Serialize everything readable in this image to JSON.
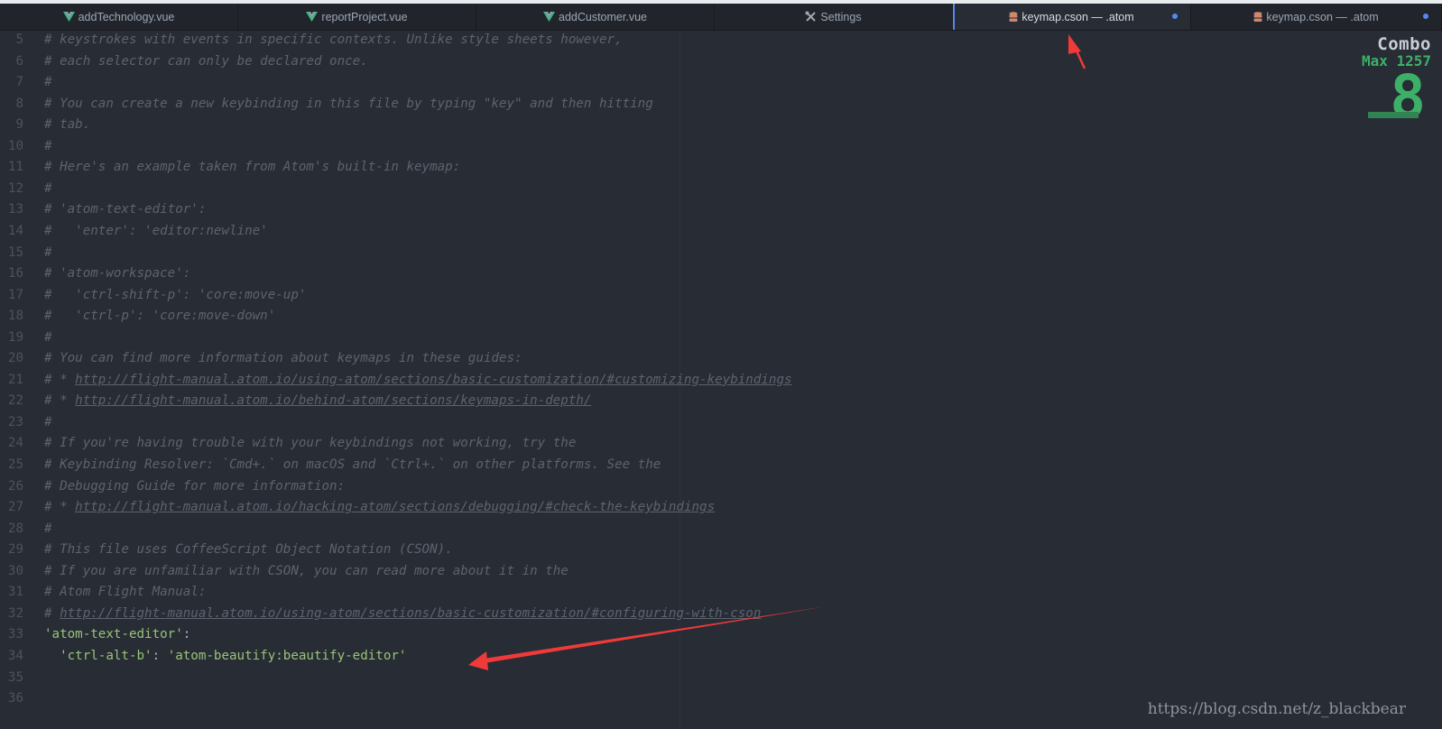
{
  "tabs": [
    {
      "label": "addTechnology.vue",
      "icon": "vue-icon",
      "active": false,
      "modified": false
    },
    {
      "label": "reportProject.vue",
      "icon": "vue-icon",
      "active": false,
      "modified": false
    },
    {
      "label": "addCustomer.vue",
      "icon": "vue-icon",
      "active": false,
      "modified": false
    },
    {
      "label": "Settings",
      "icon": "tools-icon",
      "active": false,
      "modified": false
    },
    {
      "label": "keymap.cson — .atom",
      "icon": "database-icon",
      "active": true,
      "modified": true
    },
    {
      "label": "keymap.cson — .atom",
      "icon": "database-icon",
      "active": false,
      "modified": true
    }
  ],
  "lines": [
    {
      "n": "5",
      "text": "# keystrokes with events in specific contexts. Unlike style sheets however,"
    },
    {
      "n": "6",
      "text": "# each selector can only be declared once."
    },
    {
      "n": "7",
      "text": "#"
    },
    {
      "n": "8",
      "text": "# You can create a new keybinding in this file by typing \"key\" and then hitting"
    },
    {
      "n": "9",
      "text": "# tab."
    },
    {
      "n": "10",
      "text": "#"
    },
    {
      "n": "11",
      "text": "# Here's an example taken from Atom's built-in keymap:"
    },
    {
      "n": "12",
      "text": "#"
    },
    {
      "n": "13",
      "text": "# 'atom-text-editor':"
    },
    {
      "n": "14",
      "text": "#   'enter': 'editor:newline'"
    },
    {
      "n": "15",
      "text": "#"
    },
    {
      "n": "16",
      "text": "# 'atom-workspace':"
    },
    {
      "n": "17",
      "text": "#   'ctrl-shift-p': 'core:move-up'"
    },
    {
      "n": "18",
      "text": "#   'ctrl-p': 'core:move-down'"
    },
    {
      "n": "19",
      "text": "#"
    },
    {
      "n": "20",
      "text": "# You can find more information about keymaps in these guides:"
    },
    {
      "n": "21",
      "text": "# * ",
      "link": "http://flight-manual.atom.io/using-atom/sections/basic-customization/#customizing-keybindings"
    },
    {
      "n": "22",
      "text": "# * ",
      "link": "http://flight-manual.atom.io/behind-atom/sections/keymaps-in-depth/"
    },
    {
      "n": "23",
      "text": "#"
    },
    {
      "n": "24",
      "text": "# If you're having trouble with your keybindings not working, try the"
    },
    {
      "n": "25",
      "text": "# Keybinding Resolver: `Cmd+.` on macOS and `Ctrl+.` on other platforms. See the"
    },
    {
      "n": "26",
      "text": "# Debugging Guide for more information:"
    },
    {
      "n": "27",
      "text": "# * ",
      "link": "http://flight-manual.atom.io/hacking-atom/sections/debugging/#check-the-keybindings"
    },
    {
      "n": "28",
      "text": "#"
    },
    {
      "n": "29",
      "text": "# This file uses CoffeeScript Object Notation (CSON)."
    },
    {
      "n": "30",
      "text": "# If you are unfamiliar with CSON, you can read more about it in the"
    },
    {
      "n": "31",
      "text": "# Atom Flight Manual:"
    },
    {
      "n": "32",
      "text": "# ",
      "link": "http://flight-manual.atom.io/using-atom/sections/basic-customization/#configuring-with-cson"
    },
    {
      "n": "33",
      "code": [
        {
          "t": "'atom-text-editor'",
          "k": "str"
        },
        {
          "t": ":",
          "k": "pn"
        }
      ]
    },
    {
      "n": "34",
      "code": [
        {
          "t": "  ",
          "k": "pn"
        },
        {
          "t": "'ctrl-alt-b'",
          "k": "str"
        },
        {
          "t": ": ",
          "k": "pn"
        },
        {
          "t": "'atom-beautify:beautify-editor'",
          "k": "str"
        }
      ]
    },
    {
      "n": "35",
      "text": ""
    },
    {
      "n": "36",
      "text": ""
    }
  ],
  "combo": {
    "title": "Combo",
    "max": "Max 1257",
    "count": "8"
  },
  "watermark": "https://blog.csdn.net/z_blackbear",
  "colors": {
    "accent": "#568af2",
    "combo": "#3db067",
    "string": "#98c379",
    "comment": "#5c6370",
    "annotation": "#f03a3a"
  }
}
